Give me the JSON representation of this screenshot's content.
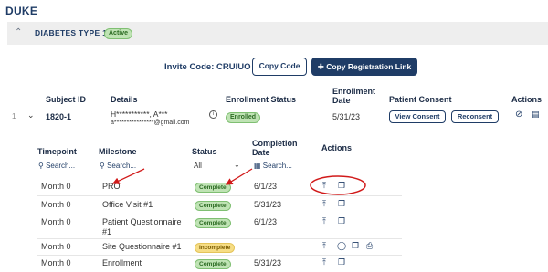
{
  "brand": "DUKE",
  "study": {
    "name": "DIABETES TYPE 1",
    "status": "Active"
  },
  "invite": {
    "label": "Invite Code: CRUIUO",
    "copy_code": "Copy Code",
    "copy_link": "Copy Registration Link"
  },
  "subjects": {
    "headers": {
      "subject_id": "Subject ID",
      "details": "Details",
      "enrollment_status": "Enrollment Status",
      "enrollment_date_1": "Enrollment",
      "enrollment_date_2": "Date",
      "patient_consent": "Patient Consent",
      "actions": "Actions"
    },
    "row": {
      "index": "1",
      "id": "1820-1",
      "name": "H***********, A***",
      "email": "a****************@gmail.com",
      "status": "Enrolled",
      "date": "5/31/23",
      "view_consent": "View Consent",
      "reconsent": "Reconsent"
    }
  },
  "milestones": {
    "headers": {
      "timepoint": "Timepoint",
      "milestone": "Milestone",
      "status": "Status",
      "completion_1": "Completion",
      "completion_2": "Date",
      "actions": "Actions"
    },
    "search_placeholder": "Search...",
    "status_filter": "All",
    "rows": [
      {
        "timepoint": "Month 0",
        "milestone": "PRO",
        "status": "Complete",
        "date": "6/1/23"
      },
      {
        "timepoint": "Month 0",
        "milestone": "Office Visit #1",
        "status": "Complete",
        "date": "5/31/23"
      },
      {
        "timepoint": "Month 0",
        "milestone": "Patient Questionnaire",
        "milestone_2": "#1",
        "status": "Complete",
        "date": "6/1/23"
      },
      {
        "timepoint": "Month 0",
        "milestone": "Site Questionnaire #1",
        "status": "Incomplete",
        "date": ""
      },
      {
        "timepoint": "Month 0",
        "milestone": "Enrollment",
        "status": "Complete",
        "date": "5/31/23"
      }
    ]
  },
  "colors": {
    "primary": "#1f3c66",
    "complete": "#bfe3b4",
    "incomplete": "#f6dd85",
    "annotation": "#d11a1a"
  }
}
